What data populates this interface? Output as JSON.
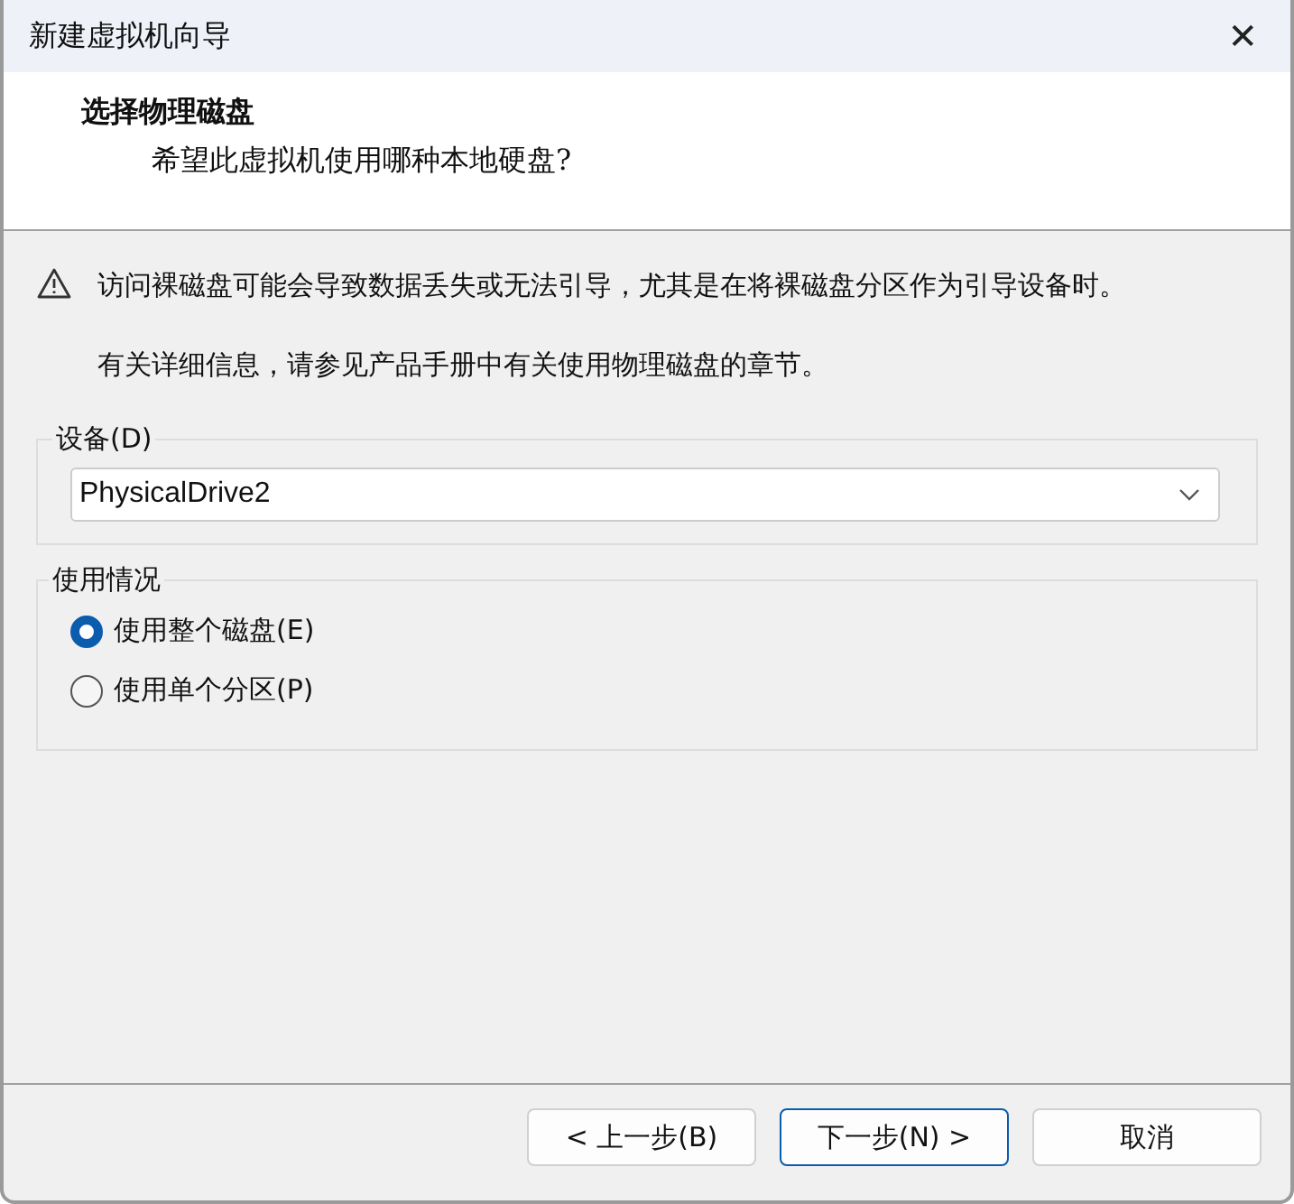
{
  "window": {
    "title": "新建虚拟机向导",
    "close": "✕"
  },
  "header": {
    "title": "选择物理磁盘",
    "subtitle": "希望此虚拟机使用哪种本地硬盘?"
  },
  "warning": {
    "text": "访问裸磁盘可能会导致数据丢失或无法引导，尤其是在将裸磁盘分区作为引导设备时。",
    "note": "有关详细信息，请参见产品手册中有关使用物理磁盘的章节。"
  },
  "device": {
    "label": "设备(D)",
    "value": "PhysicalDrive2"
  },
  "usage": {
    "label": "使用情况",
    "options": [
      {
        "label": "使用整个磁盘(E)",
        "selected": true
      },
      {
        "label": "使用单个分区(P)",
        "selected": false
      }
    ]
  },
  "buttons": [
    {
      "label": "< 上一步(B)",
      "default": false
    },
    {
      "label": "下一步(N) >",
      "default": true
    },
    {
      "label": "取消",
      "default": false
    }
  ]
}
